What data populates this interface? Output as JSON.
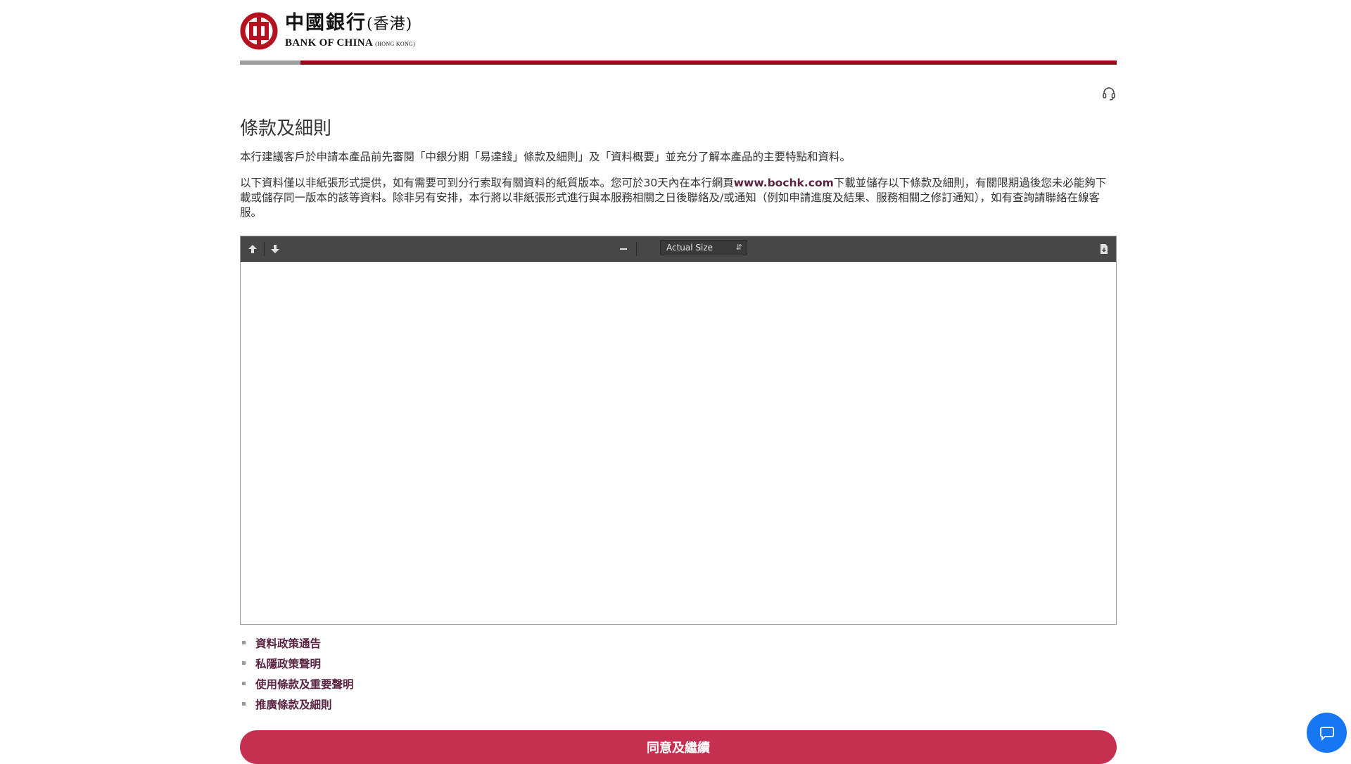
{
  "brand": {
    "logo_cn": "中國銀行",
    "logo_cn_region": "(香港)",
    "logo_en": "BANK OF CHINA",
    "logo_en_region": "(HONG KONG)",
    "accent_red": "#990a1d",
    "accent_grey": "#9e9e9e"
  },
  "page": {
    "title": "條款及細則",
    "para1": "本行建議客戶於申請本產品前先審閱「中銀分期「易達錢」條款及細則」及「資料概要」並充分了解本產品的主要特點和資料。",
    "para2_before_link": "以下資料僅以非紙張形式提供，如有需要可到分行索取有關資料的紙質版本。您可於30天內在本行網頁",
    "para2_link": "www.bochk.com",
    "para2_after_link": "下載並儲存以下條款及細則，有關限期過後您未必能夠下載或儲存同一版本的該等資料。除非另有安排，本行將以非紙張形式進行與本服務相關之日後聯絡及/或通知（例如申請進度及結果、服務相關之修訂通知），如有查詢請聯絡在線客服。"
  },
  "viewer": {
    "zoom_value": "Actual Size",
    "icons": {
      "prev": "arrow-up-icon",
      "next": "arrow-down-icon",
      "zoom_out": "minus-icon",
      "download": "download-icon"
    }
  },
  "links": [
    {
      "label": "資料政策通告"
    },
    {
      "label": "私隱政策聲明"
    },
    {
      "label": "使用條款及重要聲明"
    },
    {
      "label": "推廣條款及細則"
    }
  ],
  "actions": {
    "agree_label": "同意及繼續",
    "agree_color": "#c53050",
    "chat_color": "#1676f3"
  }
}
